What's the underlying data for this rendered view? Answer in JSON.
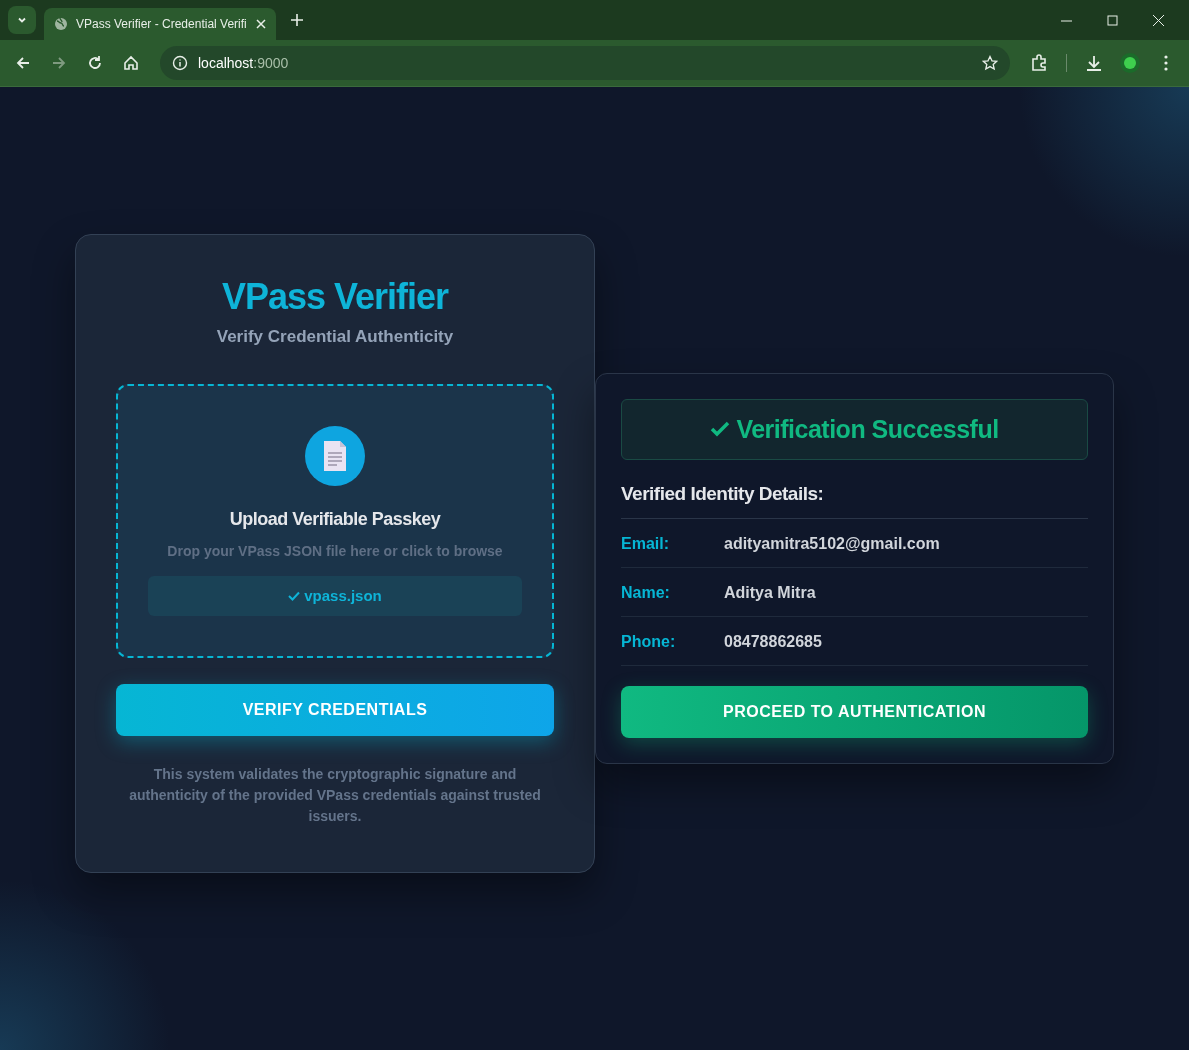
{
  "browser": {
    "tab_title": "VPass Verifier - Credential Verifi",
    "url_host": "localhost",
    "url_port": ":9000"
  },
  "verifier": {
    "title": "VPass Verifier",
    "subtitle": "Verify Credential Authenticity",
    "upload": {
      "title": "Upload Verifiable Passkey",
      "hint": "Drop your VPass JSON file here or click to browse",
      "file_name": "vpass.json",
      "file_loaded": true
    },
    "button": "VERIFY CREDENTIALS",
    "footnote": "This system validates the cryptographic signature and authenticity of the provided VPass credentials against trusted issuers."
  },
  "result": {
    "status": "Verification Successful",
    "success": true,
    "details_title": "Verified Identity Details:",
    "details": [
      {
        "label": "Email:",
        "value": "adityamitra5102@gmail.com"
      },
      {
        "label": "Name:",
        "value": "Aditya Mitra"
      },
      {
        "label": "Phone:",
        "value": "08478862685"
      }
    ],
    "button": "PROCEED TO AUTHENTICATION"
  }
}
